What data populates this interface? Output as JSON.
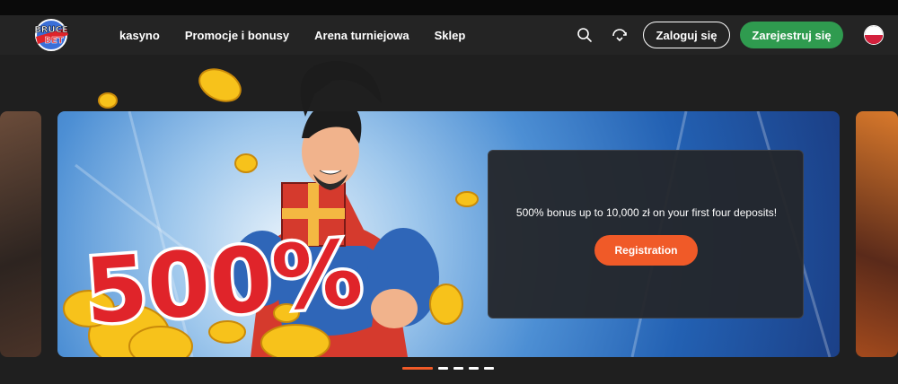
{
  "header": {
    "logo_text_top": "BRUCE",
    "logo_text_bottom": "BET",
    "nav": [
      "kasyno",
      "Promocje i bonusy",
      "Arena turniejowa",
      "Sklep"
    ],
    "search_icon": "search-icon",
    "transfer_icon": "transfer-icon",
    "login_label": "Zaloguj się",
    "register_label": "Zarejestruj się",
    "language_flag": "poland-flag-icon"
  },
  "hero": {
    "headline": "500%",
    "description": "500% bonus up to 10,000 zł on your first four deposits!",
    "cta_label": "Registration"
  },
  "colors": {
    "header_bg": "#242424",
    "register_green": "#2f9b4f",
    "cta_orange": "#f05a28",
    "headline_red": "#e0242a"
  },
  "slider": {
    "slide_count": 5,
    "active_slide": 1
  }
}
